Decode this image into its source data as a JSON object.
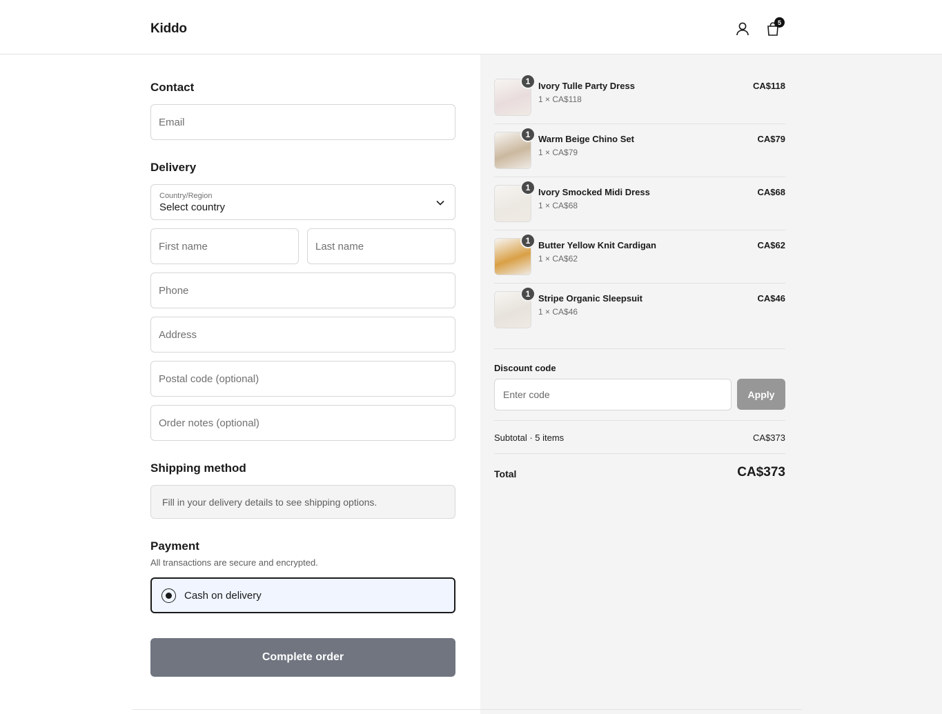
{
  "header": {
    "logo": "Kiddo",
    "cart_count": "5"
  },
  "contact": {
    "title": "Contact",
    "email_placeholder": "Email"
  },
  "delivery": {
    "title": "Delivery",
    "country_label": "Country/Region",
    "country_value": "Select country",
    "first_name_placeholder": "First name",
    "last_name_placeholder": "Last name",
    "phone_placeholder": "Phone",
    "address_placeholder": "Address",
    "postal_placeholder": "Postal code (optional)",
    "notes_placeholder": "Order notes (optional)"
  },
  "shipping": {
    "title": "Shipping method",
    "message": "Fill in your delivery details to see shipping options."
  },
  "payment": {
    "title": "Payment",
    "subtitle": "All transactions are secure and encrypted.",
    "option_label": "Cash on delivery"
  },
  "complete_label": "Complete order",
  "items": [
    {
      "name": "Ivory Tulle Party Dress",
      "qty": "1",
      "sub": "1 × CA$118",
      "price": "CA$118",
      "thumb_color": "#e9dcdd"
    },
    {
      "name": "Warm Beige Chino Set",
      "qty": "1",
      "sub": "1 × CA$79",
      "price": "CA$79",
      "thumb_color": "#cbb89f"
    },
    {
      "name": "Ivory Smocked Midi Dress",
      "qty": "1",
      "sub": "1 × CA$68",
      "price": "CA$68",
      "thumb_color": "#ece8e2"
    },
    {
      "name": "Butter Yellow Knit Cardigan",
      "qty": "1",
      "sub": "1 × CA$62",
      "price": "CA$62",
      "thumb_color": "#d9a046"
    },
    {
      "name": "Stripe Organic Sleepsuit",
      "qty": "1",
      "sub": "1 × CA$46",
      "price": "CA$46",
      "thumb_color": "#e7e3dc"
    }
  ],
  "discount": {
    "label": "Discount code",
    "placeholder": "Enter code",
    "apply_label": "Apply"
  },
  "summary": {
    "subtotal_label": "Subtotal · 5 items",
    "subtotal_value": "CA$373",
    "total_label": "Total",
    "total_value": "CA$373"
  }
}
